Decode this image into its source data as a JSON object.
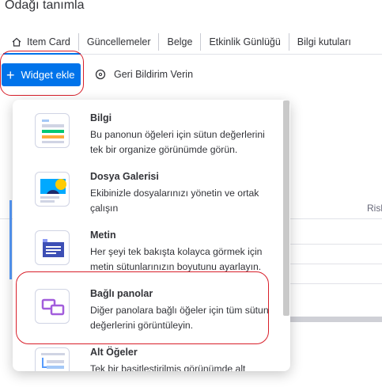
{
  "page": {
    "title": "Odağı tanımla"
  },
  "tabs": [
    {
      "label": "Item Card",
      "icon": "home-icon"
    },
    {
      "label": "Güncellemeler"
    },
    {
      "label": "Belge"
    },
    {
      "label": "Etkinlik Günlüğü"
    },
    {
      "label": "Bilgi kutuları"
    }
  ],
  "toolbar": {
    "widget_button": "Widget ekle",
    "feedback_label": "Geri Bildirim Verin"
  },
  "background": {
    "column_header": "Risk"
  },
  "dropdown": {
    "items": [
      {
        "title": "Bilgi",
        "desc": "Bu panonun öğeleri için sütun değerlerini tek bir organize görünümde görün."
      },
      {
        "title": "Dosya Galerisi",
        "desc": "Ekibinizle dosyalarınızı yönetin ve ortak çalışın"
      },
      {
        "title": "Metin",
        "desc": "Her şeyi tek bakışta kolayca görmek için metin sütunlarınızın boyutunu ayarlayın."
      },
      {
        "title": "Bağlı panolar",
        "desc": "Diğer panolara bağlı öğeler için tüm sütun değerlerini görüntüleyin."
      },
      {
        "title": "Alt Öğeler",
        "desc": "Tek bir basitleştirilmiş görünümde alt"
      }
    ]
  },
  "colors": {
    "accent": "#0073ea",
    "highlight_ring": "#d81f2a"
  }
}
